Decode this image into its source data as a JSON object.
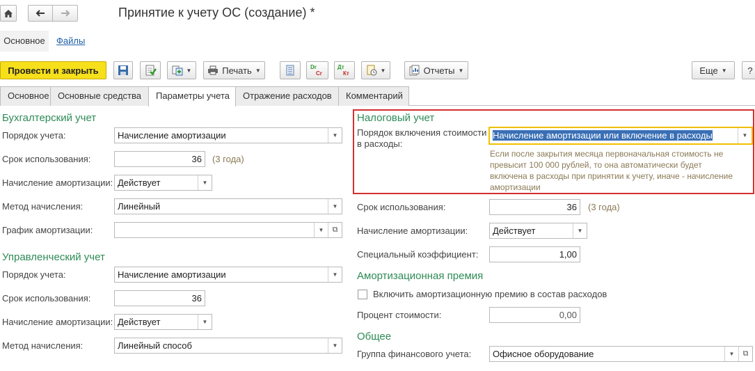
{
  "window": {
    "title": "Принятие к учету ОС (создание) *"
  },
  "icons": {
    "home": "home-icon",
    "back": "arrow-left-icon",
    "forward": "arrow-right-icon",
    "save": "floppy-disk-icon",
    "post": "post-document-icon",
    "create_based": "create-based-on-icon",
    "print": "printer-icon",
    "list": "document-list-icon",
    "dt_ct": "dt-ct-icon",
    "attach": "attachment-icon",
    "reports": "reports-icon"
  },
  "sections": {
    "main": "Основное",
    "files": "Файлы"
  },
  "toolbar": {
    "post_close": "Провести и закрыть",
    "print": "Печать",
    "reports": "Отчеты",
    "more": "Еще",
    "help": "?",
    "dr_cr_top": "Dr",
    "dr_cr_bottom": "Cr",
    "dt_kt_top": "Дт",
    "dt_kt_bottom": "Кт"
  },
  "tabs": [
    {
      "label": "Основное"
    },
    {
      "label": "Основные средства"
    },
    {
      "label": "Параметры учета"
    },
    {
      "label": "Отражение расходов"
    },
    {
      "label": "Комментарий"
    }
  ],
  "accounting": {
    "title": "Бухгалтерский учет",
    "order_label": "Порядок учета:",
    "order_value": "Начисление амортизации",
    "term_label": "Срок использования:",
    "term_value": "36",
    "term_hint": "(3 года)",
    "depr_label": "Начисление амортизации:",
    "depr_value": "Действует",
    "method_label": "Метод начисления:",
    "method_value": "Линейный",
    "schedule_label": "График амортизации:",
    "schedule_value": ""
  },
  "management": {
    "title": "Управленческий учет",
    "order_label": "Порядок учета:",
    "order_value": "Начисление амортизации",
    "term_label": "Срок использования:",
    "term_value": "36",
    "depr_label": "Начисление амортизации:",
    "depr_value": "Действует",
    "method_label": "Метод начисления:",
    "method_value": "Линейный способ"
  },
  "tax": {
    "title": "Налоговый учет",
    "cost_order_label_1": "Порядок включения стоимости",
    "cost_order_label_2": "в расходы:",
    "cost_order_value": "Начисление амортизации или включение в расходы",
    "note_1": "Если после закрытия месяца первоначальная стоимость не",
    "note_2": "превысит 100 000 рублей, то она автоматически будет",
    "note_3": "включена в расходы при принятии к учету, иначе - начисление",
    "note_4": "амортизации",
    "term_label": "Срок использования:",
    "term_value": "36",
    "term_hint": "(3 года)",
    "depr_label": "Начисление амортизации:",
    "depr_value": "Действует",
    "coef_label": "Специальный коэффициент:",
    "coef_value": "1,00"
  },
  "bonus": {
    "title": "Амортизационная премия",
    "include_label": "Включить амортизационную премию в состав расходов",
    "include_checked": false,
    "percent_label": "Процент стоимости:",
    "percent_value": "0,00"
  },
  "general": {
    "title": "Общее",
    "fin_group_label": "Группа финансового учета:",
    "fin_group_value": "Офисное оборудование"
  },
  "colors": {
    "accent_green": "#2e8b57",
    "primary_button": "#f6df1b",
    "highlight_border": "#d32f2f",
    "focus_border": "#f0c000",
    "selection": "#3a6fb5",
    "hint_text": "#8a7a55"
  }
}
